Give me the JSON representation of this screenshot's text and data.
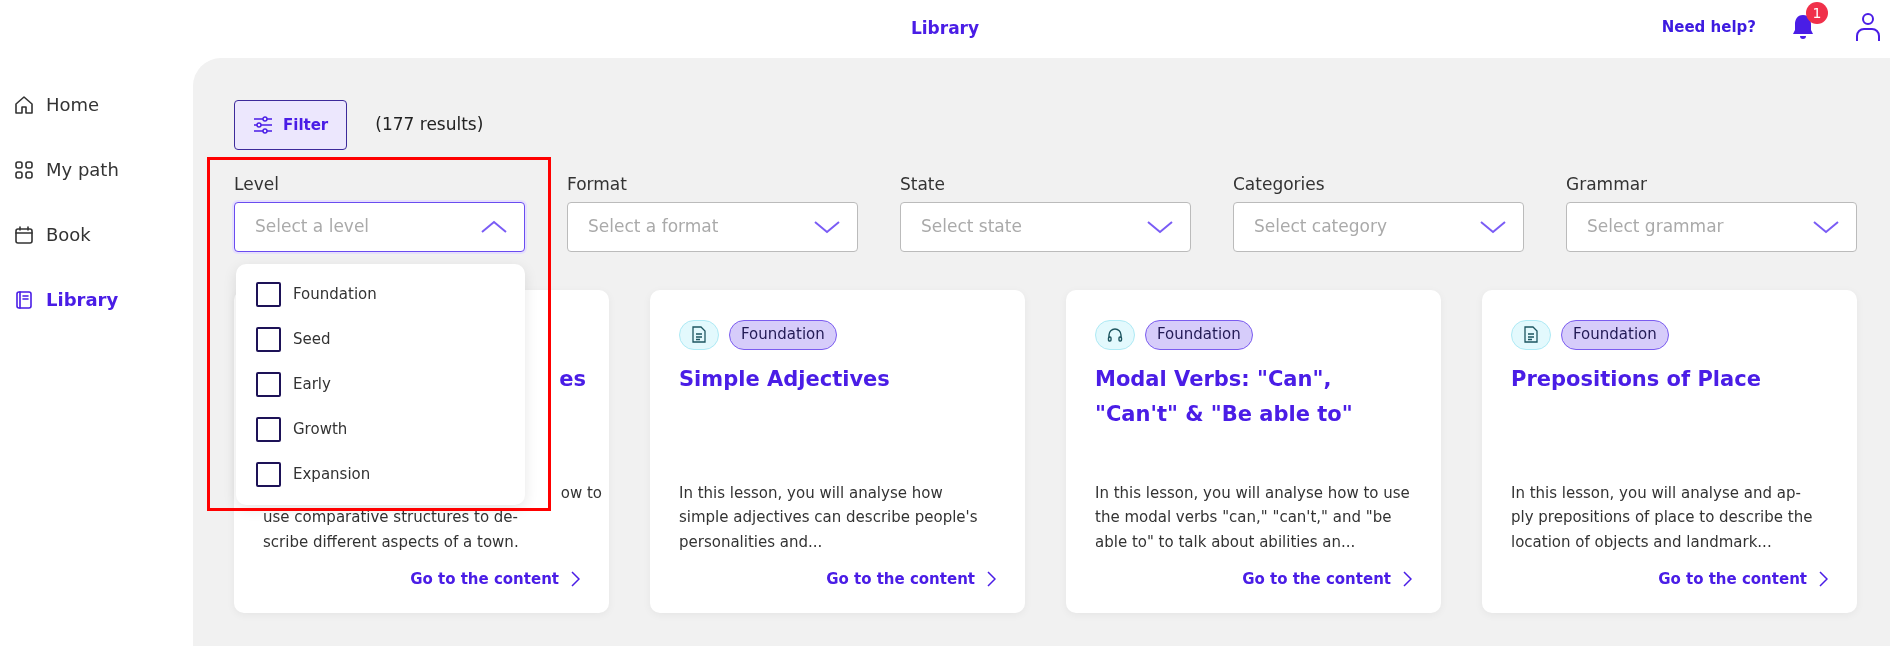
{
  "header": {
    "title": "Library",
    "help_link": "Need help?",
    "notification_count": "1"
  },
  "sidebar": {
    "items": [
      {
        "label": "Home",
        "selected": false
      },
      {
        "label": "My path",
        "selected": false
      },
      {
        "label": "Book",
        "selected": false
      },
      {
        "label": "Library",
        "selected": true
      }
    ]
  },
  "toolbar": {
    "filter_button": "Filter",
    "results": "(177 results)"
  },
  "filters": [
    {
      "label": "Level",
      "placeholder": "Select a level",
      "expanded": true
    },
    {
      "label": "Format",
      "placeholder": "Select a format",
      "expanded": false
    },
    {
      "label": "State",
      "placeholder": "Select state",
      "expanded": false
    },
    {
      "label": "Categories",
      "placeholder": "Select category",
      "expanded": false
    },
    {
      "label": "Grammar",
      "placeholder": "Select grammar",
      "expanded": false
    }
  ],
  "level_dropdown": {
    "options": [
      {
        "label": "Foundation",
        "checked": false
      },
      {
        "label": "Seed",
        "checked": false
      },
      {
        "label": "Early",
        "checked": false
      },
      {
        "label": "Growth",
        "checked": false
      },
      {
        "label": "Expansion",
        "checked": false
      }
    ]
  },
  "cards": [
    {
      "kind": "covered",
      "title": "es",
      "description_lines": [
        "ow to",
        "use comparative structures to de-",
        "scribe different aspects of a town."
      ],
      "link": "Go to the content"
    },
    {
      "kind": "document",
      "level": "Foundation",
      "title": "Simple Adjectives",
      "description": "In this lesson, you will analyse how simple adjectives can describe people's personalities and...",
      "link": "Go to the content"
    },
    {
      "kind": "audio",
      "level": "Foundation",
      "title": "Modal Verbs: \"Can\", \"Can't\" & \"Be able to\"",
      "description": "In this lesson, you will analyse how to use the modal verbs \"can,\" \"can't,\" and \"be able to\" to talk about abilities an...",
      "link": "Go to the content"
    },
    {
      "kind": "document",
      "level": "Foundation",
      "title": "Prepositions of Place",
      "description": "In this lesson, you will analyse and ap- ply prepositions of place to describe the location of objects and landmark...",
      "link": "Go to the content"
    }
  ]
}
